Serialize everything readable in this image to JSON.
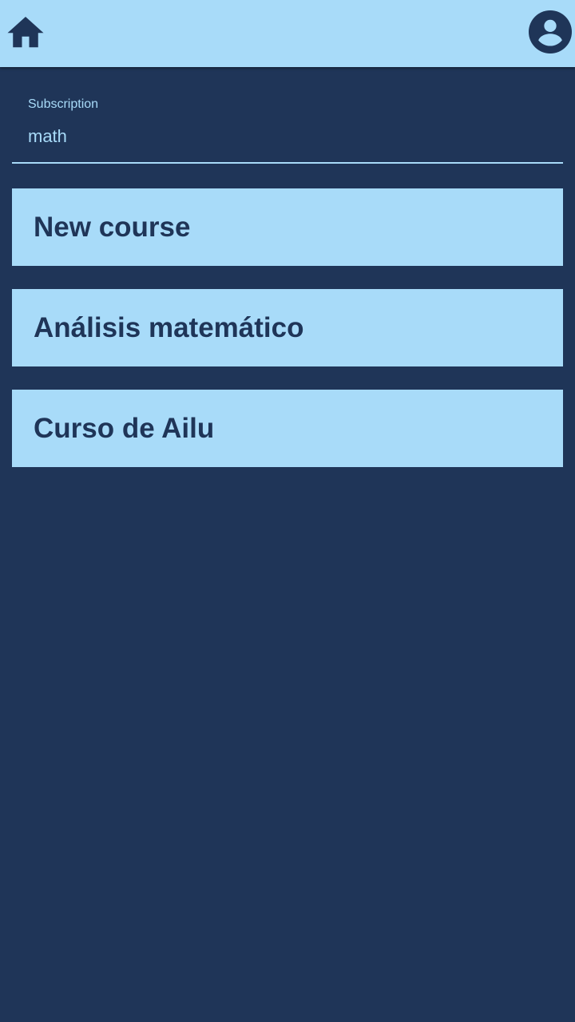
{
  "header": {
    "home_icon": "home-icon",
    "profile_icon": "account-circle-icon"
  },
  "search": {
    "label": "Subscription",
    "value": "math"
  },
  "courses": [
    {
      "title": "New course"
    },
    {
      "title": "Análisis matemático"
    },
    {
      "title": "Curso de Ailu"
    }
  ],
  "colors": {
    "primary_light": "#a8dbf9",
    "primary_dark": "#1f3558"
  }
}
